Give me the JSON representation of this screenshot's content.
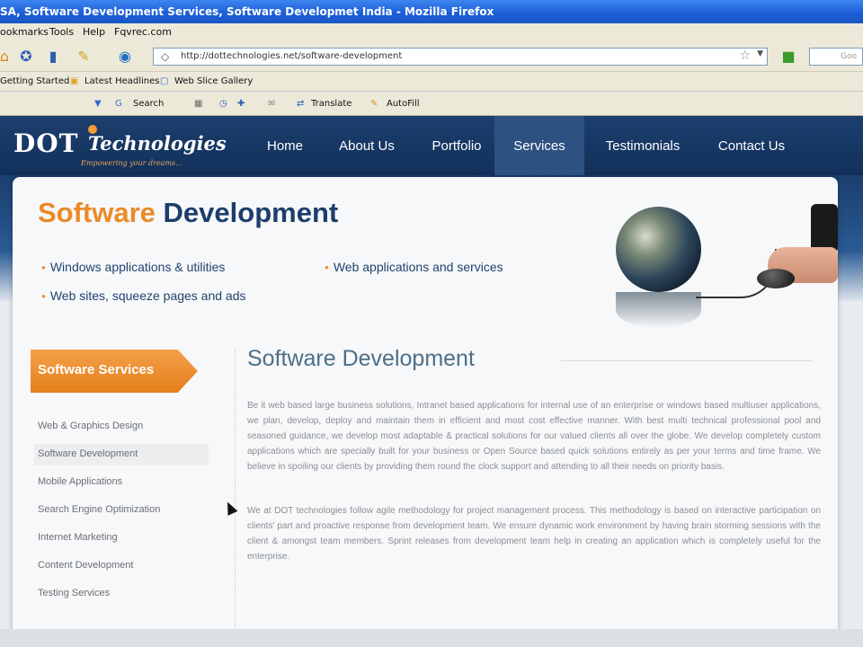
{
  "browser": {
    "window_title": "SA, Software Development Services, Software Developmet India - Mozilla Firefox",
    "menu": [
      "ookmarks",
      "Tools",
      "Help",
      "Fqvrec.com"
    ],
    "url": "http://dottechnologies.net/software-development",
    "search_placeholder": "Goo",
    "bookmarks": [
      "Getting Started",
      "Latest Headlines",
      "Web Slice Gallery"
    ],
    "toolbar": {
      "search_label": "Search",
      "translate_label": "Translate",
      "autofill_label": "AutoFill"
    }
  },
  "site": {
    "logo": {
      "name": "DOT",
      "script": "Technologies",
      "tagline": "Empowering your dreams..."
    },
    "nav": [
      "Home",
      "About Us",
      "Portfolio",
      "Services",
      "Testimonials",
      "Contact Us"
    ],
    "active_nav": "Services",
    "banner": {
      "title_part1": "Software",
      "title_part2": "Development",
      "bullets": [
        "Windows applications & utilities",
        "Web applications and services",
        "Web sites, squeeze pages and ads"
      ]
    },
    "sidebar": {
      "heading": "Software Services",
      "links": [
        "Web & Graphics Design",
        "Software Development",
        "Mobile Applications",
        "Search Engine Optimization",
        "Internet Marketing",
        "Content Development",
        "Testing Services"
      ],
      "active": "Software Development"
    },
    "content": {
      "title": "Software Development",
      "paragraphs": [
        "Be it web based large business solutions, Intranet based applications for internal use of an enterprise or windows based multiuser applications, we plan, develop, deploy and maintain them in efficient and most cost effective manner. With best multi technical professional pool and seasoned guidance, we develop most adaptable & practical solutions for our valued clients all over the globe. We develop completely custom applications which are specially built for your business or Open Source based quick solutions entirely as per your terms and time frame. We believe in spoiling our clients by providing them round the clock support and attending to all their needs on priority basis.",
        "We at DOT technologies follow agile methodology for project management process. This methodology is based on interactive participation on clients' part and proactive response from development team. We ensure dynamic work environment by having brain storming sessions with the client & amongst team members. Sprint releases from development team help in creating an application which is completely useful for the enterprise."
      ]
    }
  }
}
